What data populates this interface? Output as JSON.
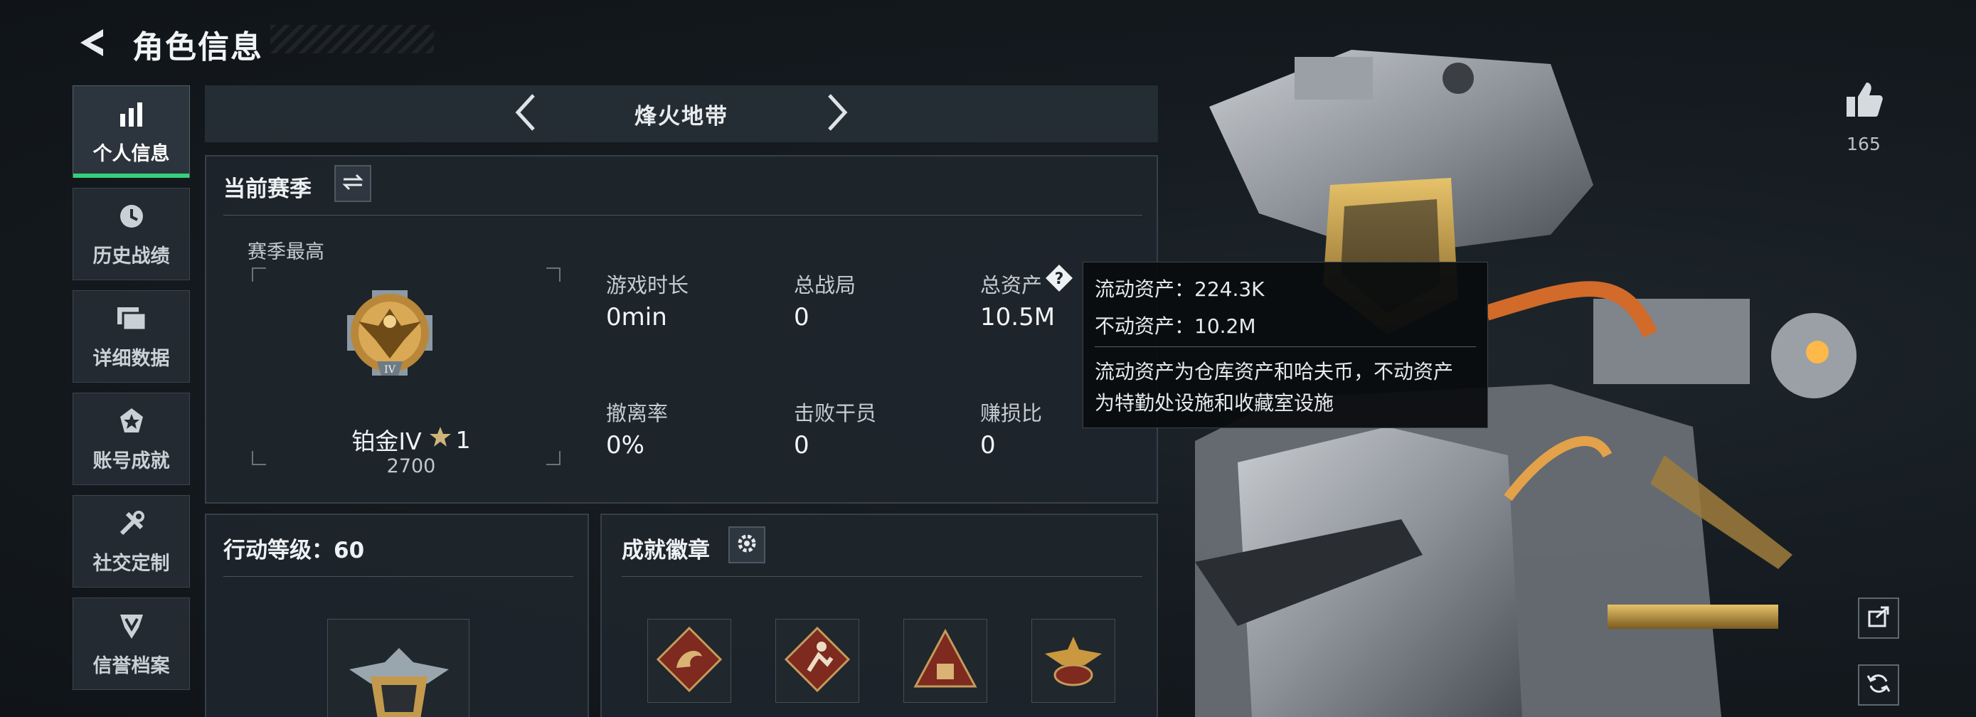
{
  "header": {
    "title": "角色信息"
  },
  "sidebar": {
    "items": [
      {
        "label": "个人信息",
        "icon": "bar-chart-icon",
        "active": true
      },
      {
        "label": "历史战绩",
        "icon": "history-icon",
        "active": false
      },
      {
        "label": "详细数据",
        "icon": "folders-icon",
        "active": false
      },
      {
        "label": "账号成就",
        "icon": "achievement-icon",
        "active": false
      },
      {
        "label": "社交定制",
        "icon": "tools-icon",
        "active": false
      },
      {
        "label": "信誉档案",
        "icon": "shield-badge-icon",
        "active": false
      }
    ]
  },
  "season_bar": {
    "name": "烽火地带"
  },
  "current_season": {
    "title": "当前赛季",
    "best_label": "赛季最高",
    "rank_name": "铂金IV",
    "rank_stars": "1",
    "rank_score": "2700",
    "stats": [
      {
        "label": "游戏时长",
        "value": "0min"
      },
      {
        "label": "总战局",
        "value": "0"
      },
      {
        "label": "总资产",
        "value": "10.5M"
      },
      {
        "label": "撤离率",
        "value": "0%"
      },
      {
        "label": "击败干员",
        "value": "0"
      },
      {
        "label": "赚损比",
        "value": "0"
      }
    ]
  },
  "tooltip": {
    "liquid": "流动资产：224.3K",
    "fixed": "不动资产：10.2M",
    "desc_line1": "流动资产为仓库资产和哈夫币，不动资产",
    "desc_line2": "为特勤处设施和收藏室设施"
  },
  "action_level": {
    "title": "行动等级：60"
  },
  "badges": {
    "title": "成就徽章"
  },
  "likes": {
    "count": "165"
  },
  "colors": {
    "accent_green": "#34d07c",
    "gold": "#c8a15a",
    "badge_red": "#8a2a1f"
  }
}
